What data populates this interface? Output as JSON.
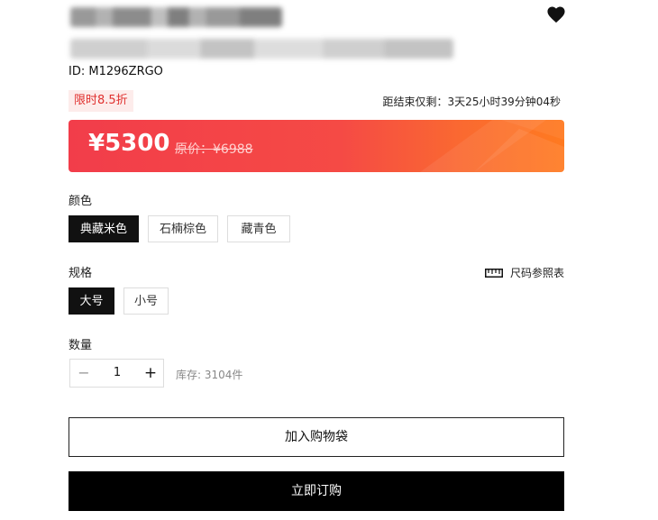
{
  "product": {
    "id_label": "ID: M1296ZRGO"
  },
  "promo": {
    "badge": "限时8.5折",
    "countdown": "距结束仅剩：3天25小时39分钟04秒"
  },
  "price": {
    "current": "¥5300",
    "original": "原价：¥6988"
  },
  "color": {
    "label": "颜色",
    "options": [
      "典藏米色",
      "石楠棕色",
      "藏青色"
    ],
    "selected": 0
  },
  "size": {
    "label": "规格",
    "chart_link": "尺码参照表",
    "options": [
      "大号",
      "小号"
    ],
    "selected": 0
  },
  "quantity": {
    "label": "数量",
    "value": "1",
    "minus": "−",
    "plus": "+",
    "stock": "库存: 3104件"
  },
  "actions": {
    "add_to_bag": "加入购物袋",
    "buy_now": "立即订购"
  },
  "colors": {
    "accent_red": "#f23d4a",
    "accent_orange": "#ff7a20",
    "promo_text": "#e0302e",
    "primary_button": "#000000"
  },
  "icons": {
    "favorite": "heart-icon",
    "size_chart": "ruler-icon"
  }
}
